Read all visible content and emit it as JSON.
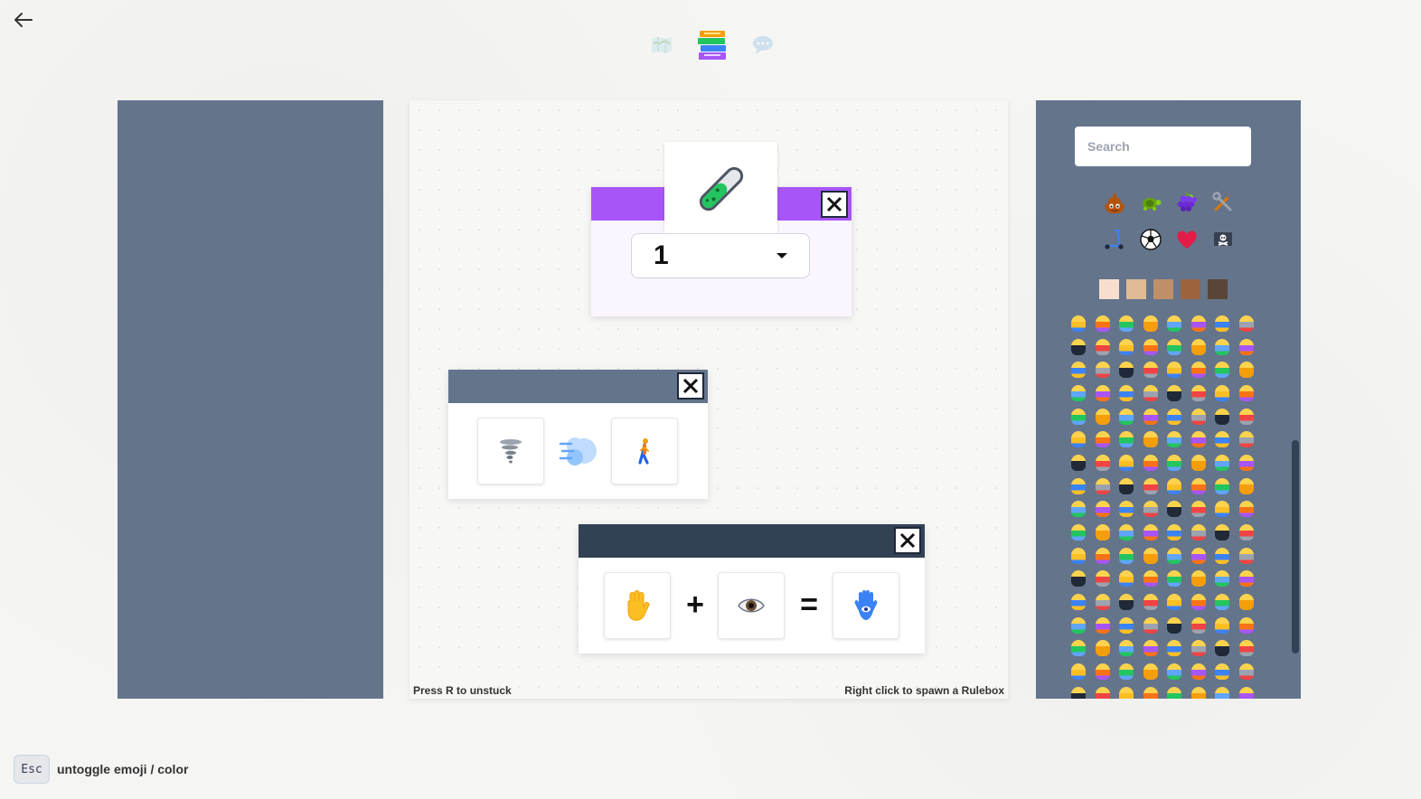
{
  "nav": {
    "back_icon": "arrow-left-icon",
    "items": [
      {
        "name": "map-icon",
        "active": false
      },
      {
        "name": "books-icon",
        "active": true
      },
      {
        "name": "speech-bubble-icon",
        "active": false
      }
    ]
  },
  "board": {
    "hint_left": "Press R to unstuck",
    "hint_right": "Right click to spawn a Rulebox"
  },
  "rulebox_potion": {
    "accent": "#a855f7",
    "emoji": "test-tube-icon",
    "select_value": "1"
  },
  "rulebox_wind": {
    "accent": "#64748b",
    "items": [
      "tornado-icon",
      "wind-face-icon",
      "person-walking-icon"
    ]
  },
  "rulebox_combine": {
    "accent": "#334155",
    "left": "raised-hand-icon",
    "plus": "+",
    "middle": "eye-icon",
    "equals": "=",
    "result": "hamsa-icon"
  },
  "palette": {
    "search_placeholder": "Search",
    "categories_row1": [
      "pile-of-poo-icon",
      "turtle-icon",
      "grapes-icon",
      "hammer-and-wrench-icon"
    ],
    "categories_row2": [
      "kick-scooter-icon",
      "soccer-ball-icon",
      "heart-icon",
      "pirate-flag-icon"
    ],
    "skin_tones": [
      "#f7dece",
      "#e0bb95",
      "#bf8f68",
      "#9b643d",
      "#594539"
    ]
  },
  "footer": {
    "key": "Esc",
    "label": "untoggle emoji / color"
  }
}
